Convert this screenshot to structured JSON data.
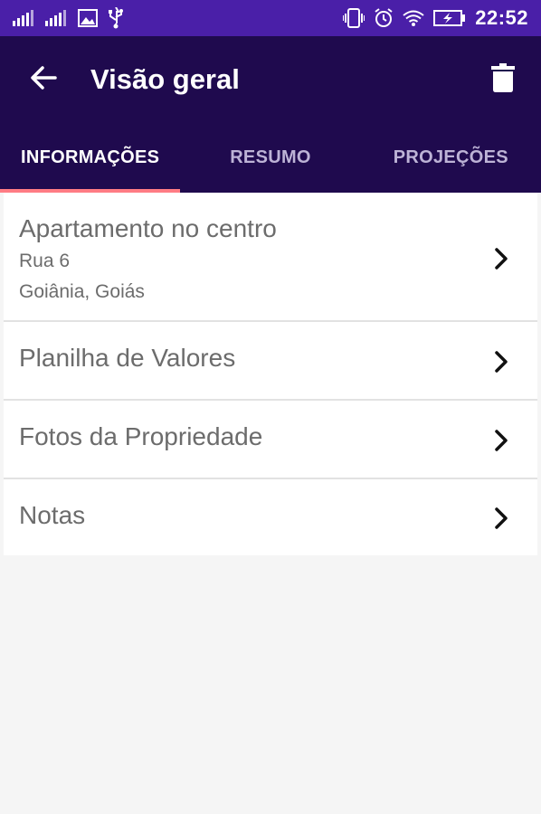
{
  "status_bar": {
    "time": "22:52",
    "icons": [
      "signal-icon",
      "signal-icon",
      "image-icon",
      "usb-icon",
      "vibrate-icon",
      "alarm-icon",
      "wifi-icon",
      "battery-charging-icon"
    ]
  },
  "app_bar": {
    "title": "Visão geral",
    "back_icon": "arrow-back-icon",
    "delete_icon": "trash-icon"
  },
  "tabs": [
    {
      "label": "INFORMAÇÕES",
      "active": true
    },
    {
      "label": "RESUMO",
      "active": false
    },
    {
      "label": "PROJEÇÕES",
      "active": false
    }
  ],
  "items": [
    {
      "title": "Apartamento no centro",
      "line1": "Rua 6",
      "line2": "Goiânia, Goiás"
    },
    {
      "title": "Planilha de Valores"
    },
    {
      "title": "Fotos da Propriedade"
    },
    {
      "title": "Notas"
    }
  ],
  "colors": {
    "status_bar": "#4a1fa8",
    "app_bar": "#1f0a4e",
    "tab_indicator": "#ff7c84",
    "background": "#f5f5f5"
  }
}
